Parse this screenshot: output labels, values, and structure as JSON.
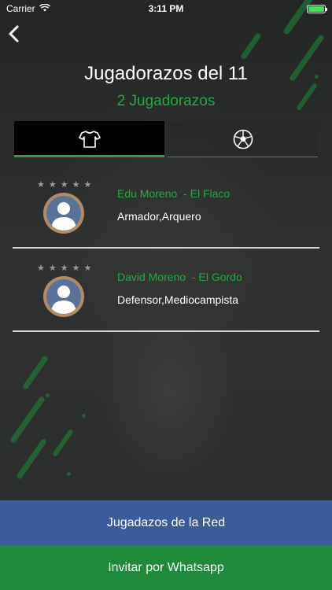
{
  "status_bar": {
    "carrier": "Carrier",
    "time": "3:11 PM",
    "battery_level": 1.0
  },
  "header": {
    "title": "Jugadorazos del 11",
    "subtitle": "2 Jugadorazos"
  },
  "tabs": [
    {
      "icon": "jersey-icon",
      "active": true
    },
    {
      "icon": "soccer-ball-icon",
      "active": false
    }
  ],
  "players": [
    {
      "name": "Edu Moreno  - El Flaco",
      "positions": "Armador,Arquero",
      "rating": 0
    },
    {
      "name": "David Moreno  - El Gordo",
      "positions": "Defensor,Mediocampista",
      "rating": 0
    }
  ],
  "buttons": {
    "network_label": "Jugadazos de la Red",
    "whatsapp_label": "Invitar por Whatsapp"
  },
  "colors": {
    "accent": "#28a744",
    "network_button": "#3c5b9a",
    "whatsapp_button": "#1f8a3a"
  }
}
